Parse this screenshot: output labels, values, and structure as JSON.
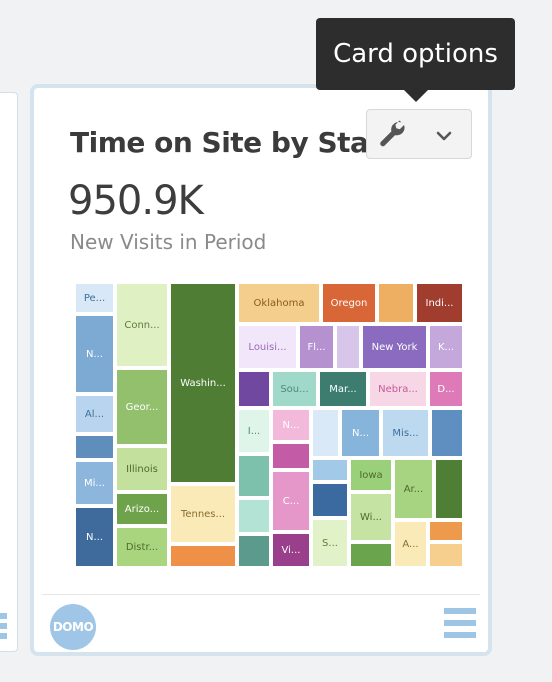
{
  "card": {
    "title": "Time on Site by State",
    "value": "950.9K",
    "subtitle": "New Visits in Period",
    "tooltip": "Card options",
    "logo_text": "DOMO"
  },
  "icons": {
    "wrench": "wrench-icon",
    "chevron": "chevron-down-icon",
    "logo": "domo-logo",
    "list": "list-view-icon"
  },
  "treemap": [
    {
      "label": "Pe...",
      "color": "#d9e8f7",
      "text_color": "#3f6f9a"
    },
    {
      "label": "N...",
      "color": "#7daad3",
      "text_color": "#ffffff"
    },
    {
      "label": "Al...",
      "color": "#b8d4ee",
      "text_color": "#3f6f9a"
    },
    {
      "label": "",
      "color": "#5f8ebc",
      "text_color": "#ffffff"
    },
    {
      "label": "Mi...",
      "color": "#8db6dc",
      "text_color": "#ffffff"
    },
    {
      "label": "N...",
      "color": "#3f6a9c",
      "text_color": "#ffffff"
    },
    {
      "label": "Conn...",
      "color": "#dff0c3",
      "text_color": "#5f7c3a"
    },
    {
      "label": "Geor...",
      "color": "#92c06d",
      "text_color": "#ffffff"
    },
    {
      "label": "Illinois",
      "color": "#c3e19c",
      "text_color": "#4f6b2c"
    },
    {
      "label": "Arizo...",
      "color": "#6ea34b",
      "text_color": "#ffffff"
    },
    {
      "label": "Distr...",
      "color": "#a9d57e",
      "text_color": "#4f6b2c"
    },
    {
      "label": "Washin...",
      "color": "#4e7d33",
      "text_color": "#ffffff"
    },
    {
      "label": "Tennes...",
      "color": "#faeab7",
      "text_color": "#8a6d2f"
    },
    {
      "label": "",
      "color": "#ee9047",
      "text_color": "#ffffff"
    },
    {
      "label": "Oklahoma",
      "color": "#f4ce8d",
      "text_color": "#8a5a1f"
    },
    {
      "label": "Oregon",
      "color": "#d86637",
      "text_color": "#ffffff"
    },
    {
      "label": "",
      "color": "#efaf62",
      "text_color": "#ffffff"
    },
    {
      "label": "Indi...",
      "color": "#a03d2f",
      "text_color": "#ffffff"
    },
    {
      "label": "Louisi...",
      "color": "#f2e6fb",
      "text_color": "#9a6bb8"
    },
    {
      "label": "Fl...",
      "color": "#b592cf",
      "text_color": "#ffffff"
    },
    {
      "label": "",
      "color": "#d8c6ea",
      "text_color": "#ffffff"
    },
    {
      "label": "New York",
      "color": "#8a6bbf",
      "text_color": "#ffffff"
    },
    {
      "label": "K...",
      "color": "#c4a8dc",
      "text_color": "#ffffff"
    },
    {
      "label": "",
      "color": "#7048a0",
      "text_color": "#ffffff"
    },
    {
      "label": "Sou...",
      "color": "#a0d8c9",
      "text_color": "#4b8a78"
    },
    {
      "label": "Mar...",
      "color": "#3c7d70",
      "text_color": "#ffffff"
    },
    {
      "label": "Nebra...",
      "color": "#f7d6e6",
      "text_color": "#c65b96"
    },
    {
      "label": "D...",
      "color": "#de7ab7",
      "text_color": "#ffffff"
    },
    {
      "label": "I...",
      "color": "#e0f5ea",
      "text_color": "#4b8a78"
    },
    {
      "label": "",
      "color": "#7dc1ad",
      "text_color": "#ffffff"
    },
    {
      "label": "",
      "color": "#b3e3d4",
      "text_color": "#ffffff"
    },
    {
      "label": "",
      "color": "#5b9a8c",
      "text_color": "#ffffff"
    },
    {
      "label": "N...",
      "color": "#f2b9db",
      "text_color": "#ffffff"
    },
    {
      "label": "",
      "color": "#c45ba6",
      "text_color": "#ffffff"
    },
    {
      "label": "C...",
      "color": "#e497c8",
      "text_color": "#ffffff"
    },
    {
      "label": "Vi...",
      "color": "#9a3f8b",
      "text_color": "#ffffff"
    },
    {
      "label": "",
      "color": "#dae9f7",
      "text_color": "#ffffff"
    },
    {
      "label": "N...",
      "color": "#86b4db",
      "text_color": "#ffffff"
    },
    {
      "label": "Mis...",
      "color": "#bcd9f0",
      "text_color": "#3f6f9a"
    },
    {
      "label": "",
      "color": "#5e8fc0",
      "text_color": "#ffffff"
    },
    {
      "label": "",
      "color": "#a3c9e8",
      "text_color": "#ffffff"
    },
    {
      "label": "",
      "color": "#3b6aa0",
      "text_color": "#ffffff"
    },
    {
      "label": "S...",
      "color": "#e2f2c8",
      "text_color": "#5f7c3a"
    },
    {
      "label": "Iowa",
      "color": "#9ad07a",
      "text_color": "#4f6b2c"
    },
    {
      "label": "Wi...",
      "color": "#c5e3a2",
      "text_color": "#4f6b2c"
    },
    {
      "label": "",
      "color": "#6aa44d",
      "text_color": "#ffffff"
    },
    {
      "label": "Ar...",
      "color": "#a6d480",
      "text_color": "#4f6b2c"
    },
    {
      "label": "",
      "color": "#4e7f35",
      "text_color": "#ffffff"
    },
    {
      "label": "A...",
      "color": "#faeab8",
      "text_color": "#8a6d2f"
    },
    {
      "label": "",
      "color": "#ee9a4c",
      "text_color": "#ffffff"
    },
    {
      "label": "",
      "color": "#f6cf8e",
      "text_color": "#ffffff"
    }
  ]
}
